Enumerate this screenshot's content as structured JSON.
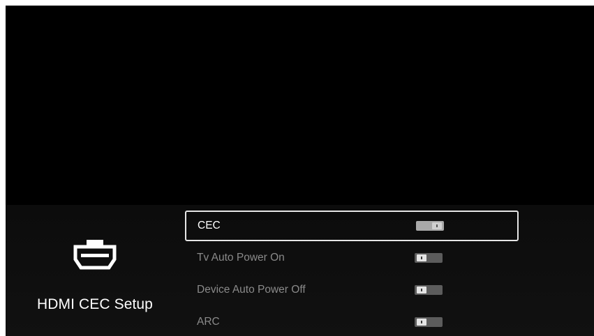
{
  "category": {
    "icon": "hdmi-port-icon",
    "label": "HDMI CEC Setup"
  },
  "menu": {
    "items": [
      {
        "label": "CEC",
        "toggle": "on",
        "focused": true
      },
      {
        "label": "Tv Auto Power On",
        "toggle": "off",
        "focused": false
      },
      {
        "label": "Device Auto Power Off",
        "toggle": "off",
        "focused": false
      },
      {
        "label": "ARC",
        "toggle": "off",
        "focused": false
      }
    ]
  },
  "colors": {
    "background": "#000000",
    "text_focused": "#ffffff",
    "text_unfocused": "#8a8a8a",
    "focus_border": "#e6e6e6",
    "toggle_on": "#a9a9a9",
    "toggle_off": "#5c5c5c"
  }
}
